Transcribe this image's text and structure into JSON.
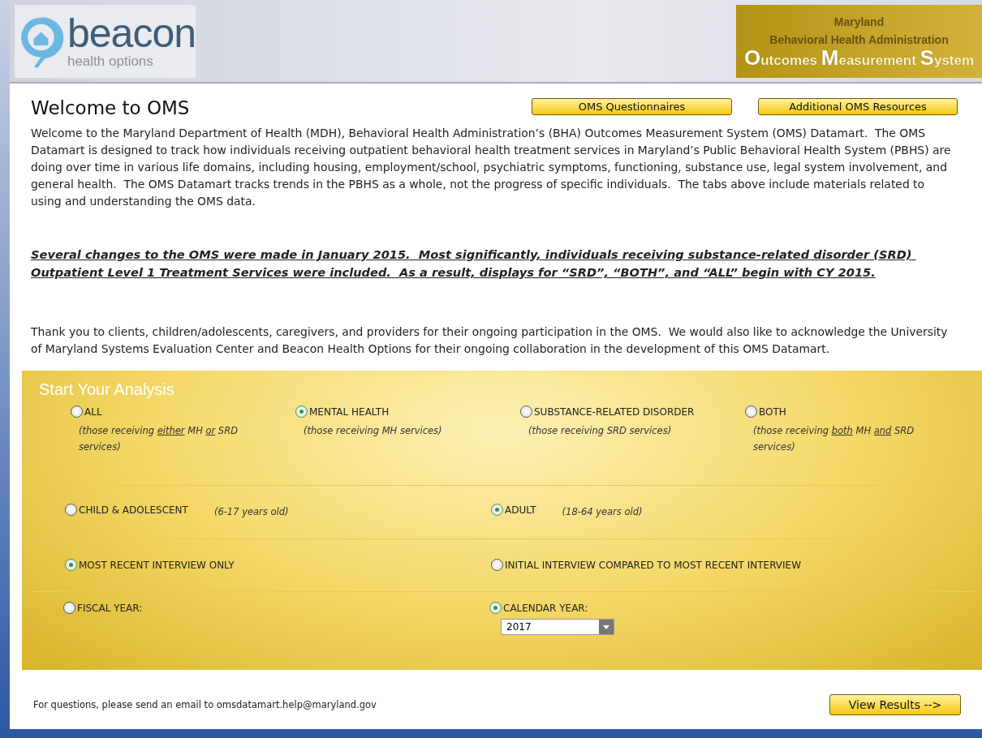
{
  "header": {
    "logo": {
      "name": "beacon",
      "tagline": "health options"
    },
    "agency": {
      "state": "Maryland",
      "department": "Behavioral Health Administration",
      "system": [
        {
          "text": "O",
          "initial": true
        },
        {
          "text": "utcomes "
        },
        {
          "text": "M",
          "initial": true
        },
        {
          "text": "easurement "
        },
        {
          "text": "S",
          "initial": true
        },
        {
          "text": "ystem"
        }
      ]
    }
  },
  "title": "Welcome to OMS",
  "buttons": [
    "OMS Questionnaires",
    "Additional OMS Resources"
  ],
  "intro": "Welcome to the Maryland Department of Health (MDH), Behavioral Health Administration’s (BHA) Outcomes Measurement System (OMS) Datamart.  The OMS Datamart is designed to track how individuals receiving outpatient behavioral health treatment services in Maryland’s Public Behavioral Health System (PBHS) are doing over time in various life domains, including housing, employment/school, psychiatric symptoms, functioning, substance use, legal system involvement, and general health.  The OMS Datamart tracks trends in the PBHS as a whole, not the progress of specific individuals.  The tabs above include materials related to using and understanding the OMS data.",
  "notice": "Several changes to the OMS were made in January 2015.  Most significantly, individuals receiving substance-related disorder (SRD) Outpatient Level 1 Treatment Services were included.  As a result, displays for “SRD”, “BOTH”, and “ALL” begin with CY 2015.",
  "thanks": "Thank you to clients, children/adolescents, caregivers, and providers for their ongoing participation in the OMS.  We would also like to acknowledge the University of Maryland Systems Evaluation Center and Beacon Health Options for their ongoing collaboration in the development of this OMS Datamart.",
  "analysis": {
    "title": "Start Your Analysis",
    "groups": [
      {
        "kind": "stacked",
        "options": [
          {
            "label": "ALL",
            "selected": false,
            "description": [
              {
                "text": "(those receiving "
              },
              {
                "text": "either",
                "underline": true
              },
              {
                "text": " MH "
              },
              {
                "text": "or",
                "underline": true
              },
              {
                "text": " SRD services)"
              }
            ]
          },
          {
            "label": "MENTAL HEALTH",
            "selected": true,
            "description": [
              {
                "text": "(those receiving MH services)"
              }
            ]
          },
          {
            "label": "SUBSTANCE-RELATED DISORDER",
            "selected": false,
            "description": [
              {
                "text": "(those receiving SRD services)"
              }
            ]
          },
          {
            "label": "BOTH",
            "selected": false,
            "description": [
              {
                "text": "(those receiving "
              },
              {
                "text": "both",
                "underline": true
              },
              {
                "text": " MH "
              },
              {
                "text": "and",
                "underline": true
              },
              {
                "text": " SRD services)"
              }
            ]
          }
        ]
      },
      {
        "kind": "inline",
        "options": [
          {
            "label": "CHILD & ADOLESCENT",
            "selected": false,
            "description": [
              {
                "text": "(6-17 years old)"
              }
            ]
          },
          {
            "label": "ADULT",
            "selected": true,
            "description": [
              {
                "text": "(18-64 years old)"
              }
            ]
          }
        ]
      },
      {
        "kind": "inline",
        "options": [
          {
            "label": "MOST RECENT INTERVIEW ONLY",
            "selected": true
          },
          {
            "label": "INITIAL INTERVIEW COMPARED TO MOST RECENT INTERVIEW",
            "selected": false
          }
        ]
      },
      {
        "kind": "inline",
        "options": [
          {
            "label": "FISCAL YEAR:",
            "selected": false
          },
          {
            "label": "CALENDAR YEAR:",
            "selected": true,
            "dropdown": {
              "value": "2017"
            }
          }
        ]
      }
    ]
  },
  "footer": {
    "contact": "For questions, please send an email to omsdatamart.help@maryland.gov",
    "button": "View Results -->"
  }
}
